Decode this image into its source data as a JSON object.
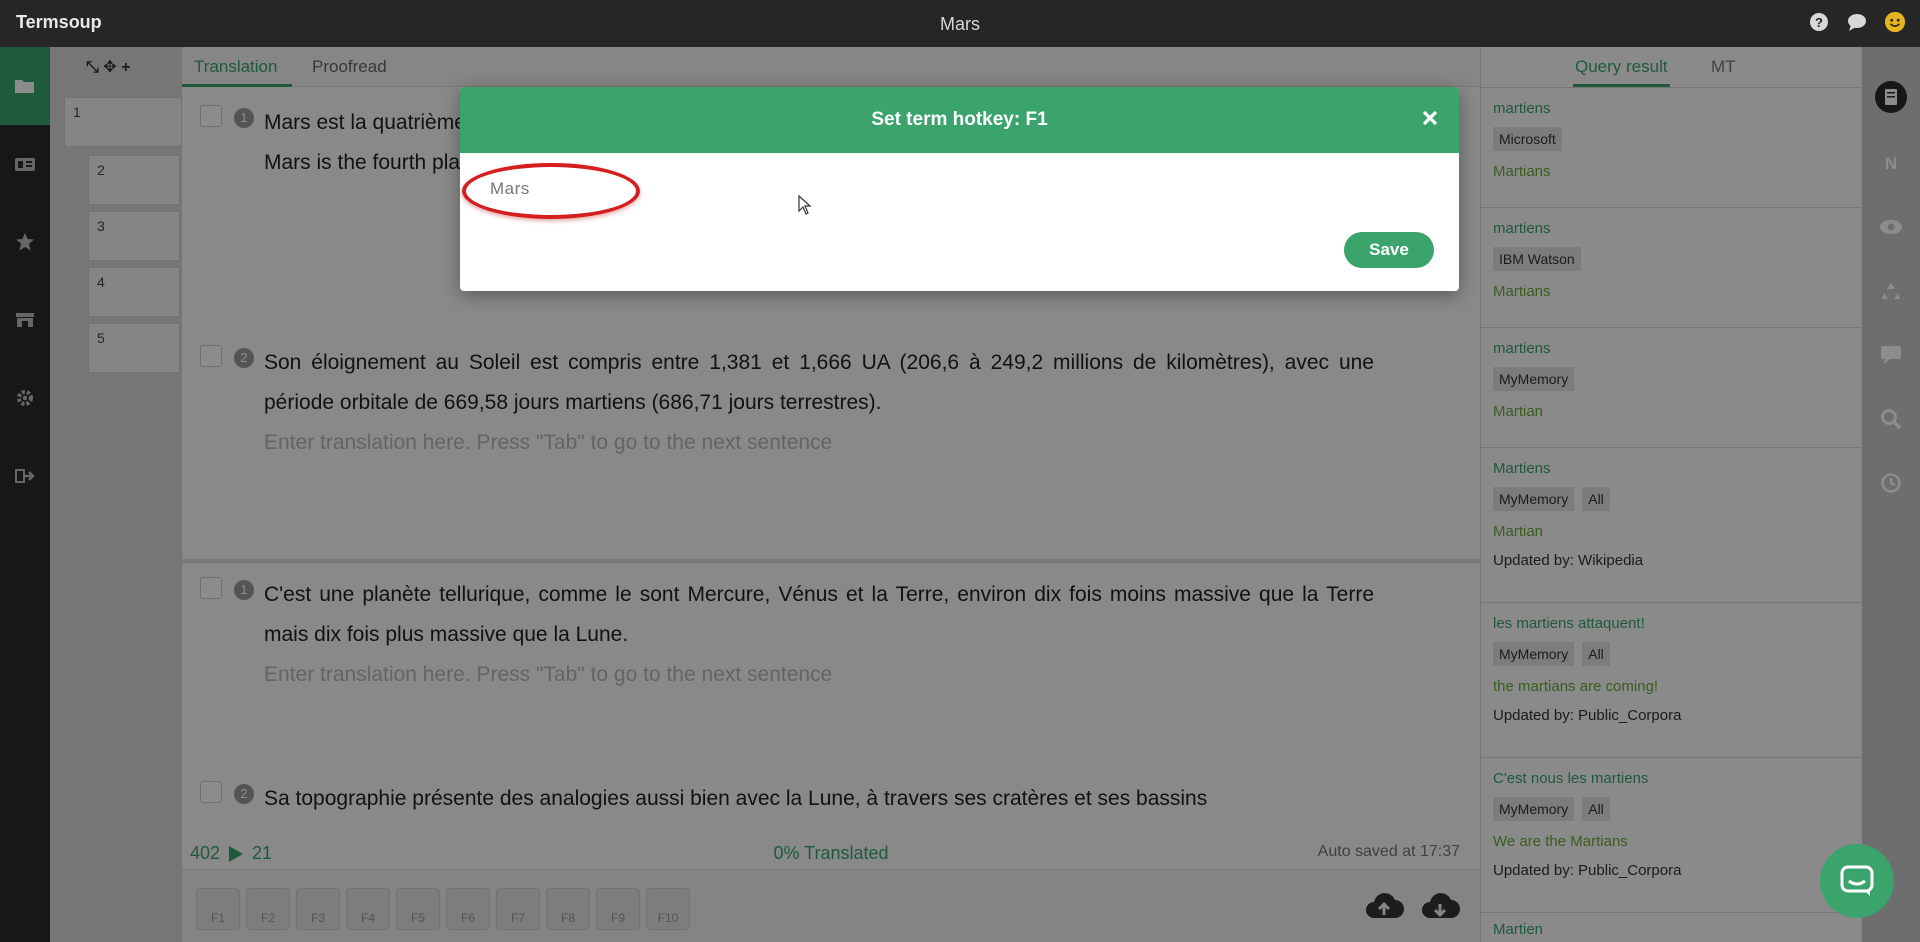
{
  "app": {
    "brand": "Termsoup",
    "document_title": "Mars"
  },
  "paragraphs": {
    "tools": "⤡ ✥ +",
    "items": [
      "1",
      "2",
      "3",
      "4",
      "5"
    ]
  },
  "editor": {
    "tabs": [
      {
        "label": "Translation"
      },
      {
        "label": "Proofread"
      }
    ],
    "segments_upper": [
      {
        "num": "1",
        "source": "Mars est la quatrième planète du Système solaire par ordre croissant de la distance au Soleil et de taille croissantes.",
        "target": "Mars is the fourth planet of the Solar System in increasing order of distance from the Sun and size."
      },
      {
        "num": "2",
        "source": "Son éloignement au Soleil est compris entre 1,381 et 1,666 UA (206,6 à 249,2 millions de kilomètres), avec une période orbitale de 669,58 jours martiens (686,71 jours terrestres).",
        "placeholder": "Enter translation here. Press \"Tab\" to go to the next sentence"
      }
    ],
    "segments_lower": [
      {
        "num": "1",
        "source": "C'est une planète tellurique, comme le sont Mercure, Vénus et la Terre, environ dix fois moins massive que la Terre mais dix fois plus massive que la Lune.",
        "placeholder": "Enter translation here. Press \"Tab\" to go to the next sentence"
      },
      {
        "num": "2",
        "source": "Sa topographie présente des analogies aussi bien avec la Lune, à travers ses cratères et ses bassins"
      }
    ],
    "status": {
      "words_total": "402",
      "words_done": "21",
      "percent": "0% Translated",
      "autosave": "Auto saved at 17:37"
    },
    "hotkeys": [
      "F1",
      "F2",
      "F3",
      "F4",
      "F5",
      "F6",
      "F7",
      "F8",
      "F9",
      "F10"
    ]
  },
  "right_panel": {
    "tabs": [
      {
        "label": "Query result"
      },
      {
        "label": "MT"
      }
    ],
    "results": [
      {
        "term": "martiens",
        "tags": [
          "Microsoft"
        ],
        "translation": "Martians",
        "updated": ""
      },
      {
        "term": "martiens",
        "tags": [
          "IBM  Watson"
        ],
        "translation": "Martians",
        "updated": ""
      },
      {
        "term": "martiens",
        "tags": [
          "MyMemory"
        ],
        "translation": "Martian",
        "updated": ""
      },
      {
        "term": "Martiens",
        "tags": [
          "MyMemory",
          "All"
        ],
        "translation": "Martian",
        "updated": "Updated  by:  Wikipedia"
      },
      {
        "term": "les martiens attaquent!",
        "tags": [
          "MyMemory",
          "All"
        ],
        "translation": "the martians are coming!",
        "updated": "Updated  by:  Public_Corpora"
      },
      {
        "term": "C'est nous les martiens",
        "tags": [
          "MyMemory",
          "All"
        ],
        "translation": "We are the Martians",
        "updated": "Updated  by:  Public_Corpora"
      },
      {
        "term": "Martien",
        "tags": [],
        "translation": "",
        "updated": ""
      }
    ]
  },
  "modal": {
    "title": "Set term hotkey: F1",
    "input_value": "Mars",
    "save_label": "Save"
  },
  "colors": {
    "accent": "#3aa46c",
    "topbar": "#262626",
    "highlight": "#d51e1e"
  }
}
